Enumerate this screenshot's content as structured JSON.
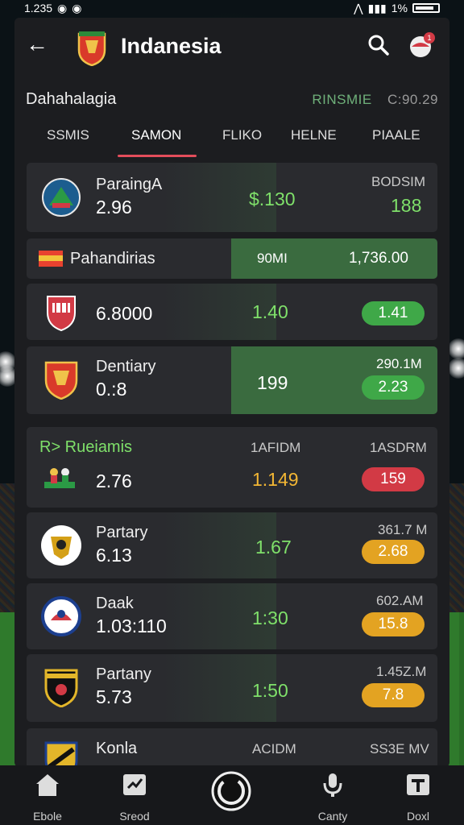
{
  "status_bar": {
    "time": "1.235",
    "battery_text": "1%"
  },
  "header": {
    "title": "Indanesia",
    "back_icon": "arrow-left-icon",
    "search_icon": "search-icon",
    "notification_badge": "1"
  },
  "subbar": {
    "title": "Dahahalagia",
    "right_label": "RINSMIE",
    "right_value": "C:90.29"
  },
  "tabs": [
    {
      "label": "SSMIS"
    },
    {
      "label": "SAMON",
      "active": true
    },
    {
      "label": "FLIKO"
    },
    {
      "label": "HELNE"
    },
    {
      "label": "PIAALE"
    }
  ],
  "rows": [
    {
      "name": "ParaingA",
      "value": "2.96",
      "mid": "$.130",
      "small": "BODSIM",
      "right": "188"
    },
    {
      "name": "Pahandirias",
      "mid": "90MI",
      "right": "1,736.00"
    },
    {
      "value": "6.8000",
      "mid": "1.40",
      "pill": "1.41"
    },
    {
      "name": "Dentiary",
      "value": "0.:8",
      "mid": "199",
      "small": "290.1M",
      "pill": "2.23"
    },
    {
      "name": "R> Rueiamis",
      "value": "2.76",
      "small_mid": "1AFIDM",
      "mid": "1.149",
      "small": "1ASDRM",
      "pill": "159"
    },
    {
      "name": "Partary",
      "value": "6.13",
      "mid": "1.67",
      "small": "361.7 M",
      "pill": "2.68"
    },
    {
      "name": "Daak",
      "value": "1.03:110",
      "mid": "1:30",
      "small": "602.AM",
      "pill": "15.8"
    },
    {
      "name": "Partany",
      "value": "5.73",
      "mid": "1:50",
      "small": "1.45Z.M",
      "pill": "7.8"
    },
    {
      "name": "Konla",
      "small_mid": "ACIDM",
      "small": "SS3E MV"
    }
  ],
  "bottom_nav": [
    {
      "label": "Ebole",
      "icon": "home-icon"
    },
    {
      "label": "Sreod",
      "icon": "stats-icon"
    },
    {
      "label": "",
      "icon": "ball-icon"
    },
    {
      "label": "Canty",
      "icon": "microphone-icon"
    },
    {
      "label": "Doxl",
      "icon": "profile-icon"
    }
  ],
  "colors": {
    "accent": "#e34d5b",
    "green": "#7fe06a",
    "yellow": "#f2b634",
    "pill_green": "#3fa848",
    "pill_red": "#d23a45",
    "pill_yellow": "#e3a322"
  }
}
